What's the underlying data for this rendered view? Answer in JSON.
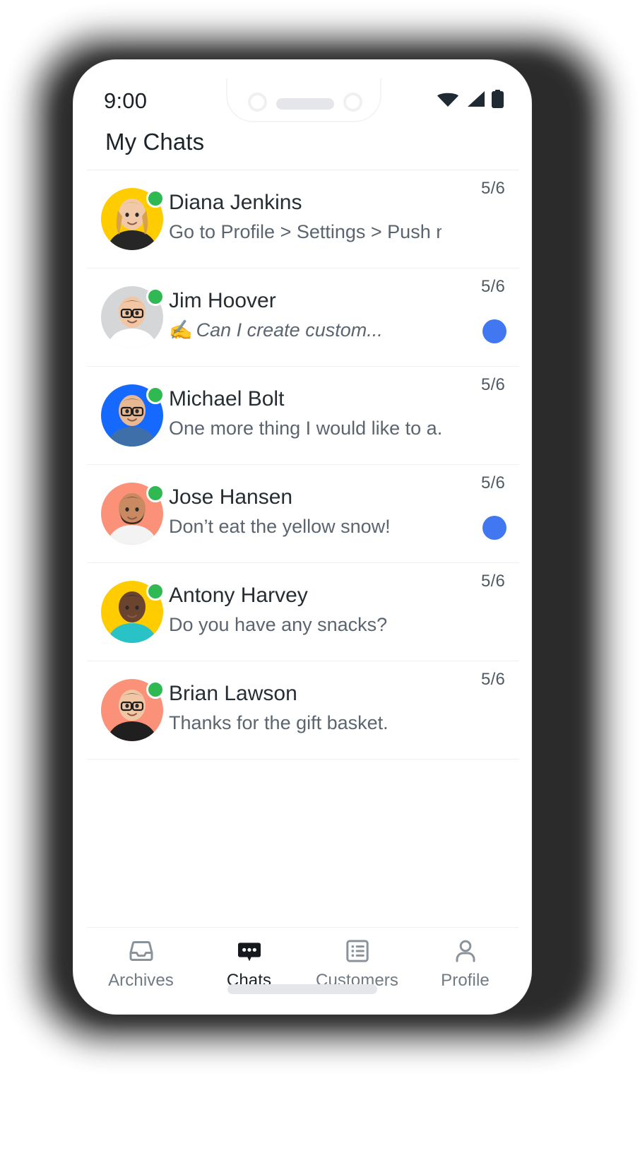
{
  "status_bar": {
    "time": "9:00",
    "icons": [
      "wifi-icon",
      "cellular-signal-icon",
      "battery-icon"
    ]
  },
  "header": {
    "title": "My Chats"
  },
  "colors": {
    "accent_blue": "#4277f2",
    "presence_green": "#30b952",
    "avatar_yellow": "#ffcc00",
    "avatar_gray": "#d4d6d8",
    "avatar_blue": "#1569ff",
    "avatar_coral": "#fb9179",
    "text_primary": "#262d33",
    "text_secondary": "#5b6570"
  },
  "chats": [
    {
      "name": "Diana Jenkins",
      "message": "Go to Profile > Settings > Push notifica...",
      "time": "5/6",
      "online": true,
      "unread": false,
      "typing": false,
      "avatar_bg": "#ffcc00"
    },
    {
      "name": "Jim Hoover",
      "message": "Can I create custom...",
      "typing_emoji": "✍️",
      "time": "5/6",
      "online": true,
      "unread": true,
      "typing": true,
      "avatar_bg": "#d4d6d8"
    },
    {
      "name": "Michael Bolt",
      "message": "One more thing I would like to a...",
      "time": "5/6",
      "online": true,
      "unread": false,
      "typing": false,
      "avatar_bg": "#1569ff"
    },
    {
      "name": "Jose Hansen",
      "message": "Don’t eat the yellow snow!",
      "time": "5/6",
      "online": true,
      "unread": true,
      "typing": false,
      "avatar_bg": "#fb9179"
    },
    {
      "name": "Antony Harvey",
      "message": "Do you have any snacks?",
      "time": "5/6",
      "online": true,
      "unread": false,
      "typing": false,
      "avatar_bg": "#ffcc00"
    },
    {
      "name": "Brian Lawson",
      "message": "Thanks for the gift basket.",
      "time": "5/6",
      "online": true,
      "unread": false,
      "typing": false,
      "avatar_bg": "#fb9179"
    }
  ],
  "bottom_nav": {
    "items": [
      {
        "label": "Archives",
        "icon": "archive-tray-icon",
        "active": false
      },
      {
        "label": "Chats",
        "icon": "chat-bubble-icon",
        "active": true
      },
      {
        "label": "Customers",
        "icon": "list-icon",
        "active": false
      },
      {
        "label": "Profile",
        "icon": "person-icon",
        "active": false
      }
    ]
  }
}
